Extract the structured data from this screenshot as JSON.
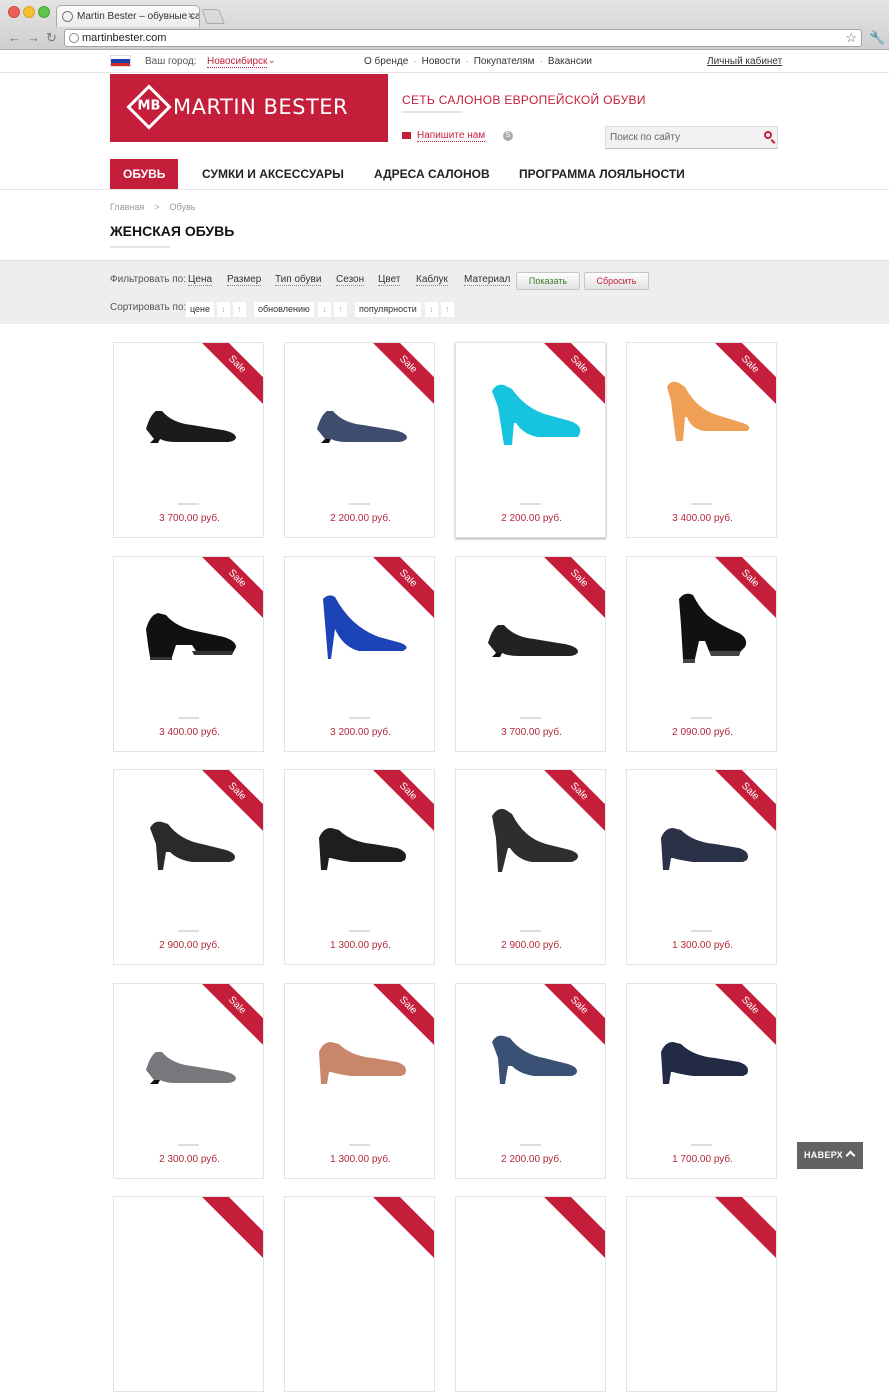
{
  "browser": {
    "tab_title": "Martin Bester – обувные сал",
    "url": "martinbester.com"
  },
  "topbar": {
    "city_label": "Ваш город:",
    "city": "Новосибирск",
    "links": [
      "О бренде",
      "Новости",
      "Покупателям",
      "Вакансии"
    ],
    "cabinet": "Личный кабинет"
  },
  "header": {
    "logo_text": "MARTIN BESTER",
    "logo_mark": "MB",
    "tagline": "СЕТЬ САЛОНОВ ЕВРОПЕЙСКОЙ ОБУВИ",
    "write_us": "Напишите нам",
    "search_placeholder": "Поиск по сайту"
  },
  "nav": [
    "ОБУВЬ",
    "СУМКИ И АКСЕССУАРЫ",
    "АДРЕСА САЛОНОВ",
    "ПРОГРАММА ЛОЯЛЬНОСТИ"
  ],
  "breadcrumb": {
    "home": "Главная",
    "separator": ">",
    "current": "Обувь"
  },
  "page_title": "ЖЕНСКАЯ ОБУВЬ",
  "filters": {
    "label": "Фильтровать по:",
    "options": [
      "Цена",
      "Размер",
      "Тип обуви",
      "Сезон",
      "Цвет",
      "Каблук",
      "Материал"
    ],
    "show_button": "Показать",
    "reset_button": "Сбросить",
    "sort_label": "Сортировать по:",
    "sort_options": [
      "цене",
      "обновлению",
      "популярности"
    ],
    "arrow_down": "↓",
    "arrow_up": "↑"
  },
  "products": [
    {
      "badge": "Sale",
      "price": "3 700.00 руб.",
      "shoe": "wedge",
      "color": "#1b1b1b"
    },
    {
      "badge": "Sale",
      "price": "2 200.00 руб.",
      "shoe": "wedge",
      "color": "#3e4c6e"
    },
    {
      "badge": "Sale",
      "price": "2 200.00 руб.",
      "shoe": "platform",
      "color": "#16c4e0"
    },
    {
      "badge": "Sale",
      "price": "3 400.00 руб.",
      "shoe": "block",
      "color": "#f0a055"
    },
    {
      "badge": "Sale",
      "price": "3 400.00 руб.",
      "shoe": "lug",
      "color": "#111111"
    },
    {
      "badge": "Sale",
      "price": "3 200.00 руб.",
      "shoe": "stiletto",
      "color": "#1c44b8"
    },
    {
      "badge": "Sale",
      "price": "3 700.00 руб.",
      "shoe": "wedge",
      "color": "#222222"
    },
    {
      "badge": "Sale",
      "price": "2 090.00 руб.",
      "shoe": "lug-high",
      "color": "#111111"
    },
    {
      "badge": "Sale",
      "price": "2 900.00 руб.",
      "shoe": "mid",
      "color": "#2a2a2a"
    },
    {
      "badge": "Sale",
      "price": "1 300.00 руб.",
      "shoe": "low",
      "color": "#1e1e1e"
    },
    {
      "badge": "Sale",
      "price": "2 900.00 руб.",
      "shoe": "high",
      "color": "#2e2e2e"
    },
    {
      "badge": "Sale",
      "price": "1 300.00 руб.",
      "shoe": "low",
      "color": "#2b3247"
    },
    {
      "badge": "Sale",
      "price": "2 300.00 руб.",
      "shoe": "wedge",
      "color": "#77777c"
    },
    {
      "badge": "Sale",
      "price": "1 300.00 руб.",
      "shoe": "low",
      "color": "#c8876a"
    },
    {
      "badge": "Sale",
      "price": "2 200.00 руб.",
      "shoe": "mid",
      "color": "#3a5175"
    },
    {
      "badge": "Sale",
      "price": "1 700.00 руб.",
      "shoe": "low",
      "color": "#222a44"
    }
  ],
  "to_top": "НАВЕРХ",
  "colors": {
    "accent": "#c41e3a",
    "price": "#b3283b"
  }
}
